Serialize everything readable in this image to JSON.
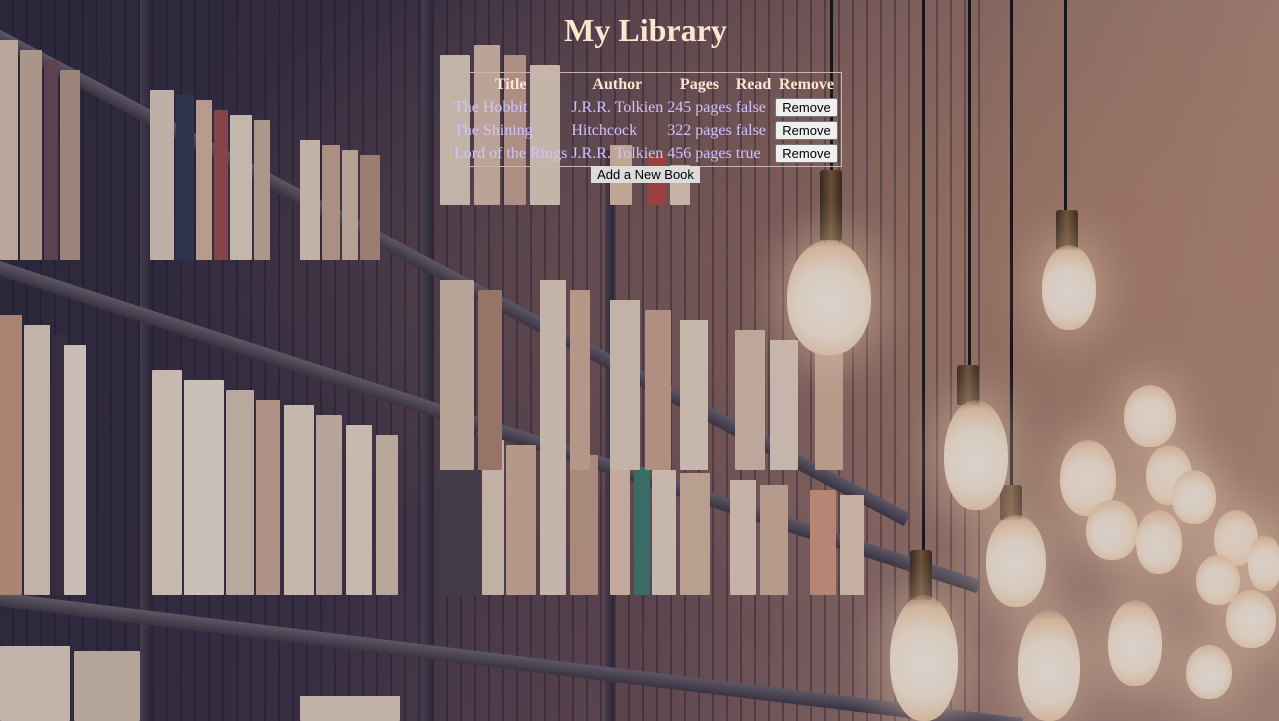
{
  "page": {
    "title": "My Library"
  },
  "table": {
    "headers": [
      "Title",
      "Author",
      "Pages",
      "Read",
      "Remove"
    ],
    "rows": [
      {
        "title": "The Hobbit",
        "author": "J.R.R. Tolkien",
        "pages": "245 pages",
        "read": "false",
        "remove_label": "Remove"
      },
      {
        "title": "The Shining",
        "author": "Hitchcock",
        "pages": "322 pages",
        "read": "false",
        "remove_label": "Remove"
      },
      {
        "title": "Lord of the Rings",
        "author": "J.R.R. Tolkien",
        "pages": "456 pages",
        "read": "true",
        "remove_label": "Remove"
      }
    ]
  },
  "actions": {
    "add_label": "Add a New Book"
  },
  "colors": {
    "heading": "#fde6cf",
    "cell_text": "#cfc2ff",
    "table_border": "#c9b6a8"
  },
  "background": {
    "description_icon": "library-bookshelf-with-hanging-bulbs-image"
  }
}
